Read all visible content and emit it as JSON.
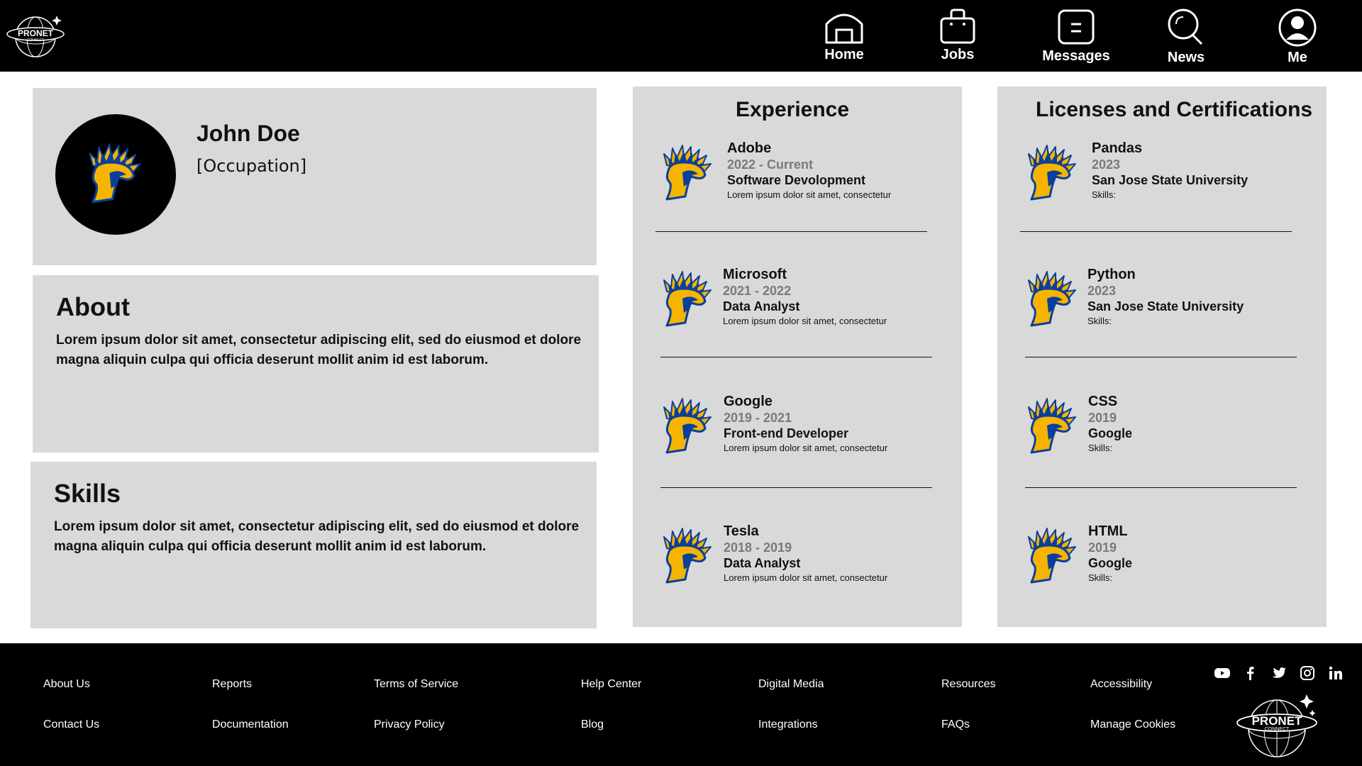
{
  "brand": {
    "logo_text": "PRONET",
    "logo_sub": "CONNECT"
  },
  "nav": {
    "items": [
      {
        "label": "Home",
        "icon": "home-icon"
      },
      {
        "label": "Jobs",
        "icon": "briefcase-icon"
      },
      {
        "label": "Messages",
        "icon": "message-icon"
      },
      {
        "label": "News",
        "icon": "search-icon"
      },
      {
        "label": "Me",
        "icon": "user-icon"
      }
    ]
  },
  "profile": {
    "name": "John Doe",
    "occupation": "[Occupation]"
  },
  "about": {
    "title": "About",
    "body": "Lorem ipsum dolor sit amet, consectetur adipiscing elit, sed do eiusmod  et dolore magna aliquin culpa qui officia deserunt mollit anim id est laborum."
  },
  "skills": {
    "title": "Skills",
    "body": "Lorem ipsum dolor sit amet, consectetur adipiscing elit, sed do eiusmod  et dolore magna aliquin culpa qui officia deserunt mollit anim id est laborum."
  },
  "experience": {
    "title": "Experience",
    "items": [
      {
        "company": "Adobe",
        "dates": "2022 - Current",
        "role": "Software Devolopment",
        "desc": "Lorem ipsum dolor sit amet, consectetur"
      },
      {
        "company": "Microsoft",
        "dates": "2021 - 2022",
        "role": "Data Analyst",
        "desc": "Lorem ipsum dolor sit amet, consectetur"
      },
      {
        "company": "Google",
        "dates": "2019 - 2021",
        "role": "Front-end Developer",
        "desc": "Lorem ipsum dolor sit amet, consectetur"
      },
      {
        "company": "Tesla",
        "dates": "2018 - 2019",
        "role": "Data Analyst",
        "desc": "Lorem ipsum dolor sit amet, consectetur"
      }
    ]
  },
  "licenses": {
    "title": "Licenses and Certifications",
    "items": [
      {
        "name": "Pandas",
        "year": "2023",
        "issuer": "San Jose State University",
        "skills": "Skills:"
      },
      {
        "name": "Python",
        "year": "2023",
        "issuer": "San Jose State University",
        "skills": "Skills:"
      },
      {
        "name": "CSS",
        "year": "2019",
        "issuer": "Google",
        "skills": "Skills:"
      },
      {
        "name": "HTML",
        "year": "2019",
        "issuer": "Google",
        "skills": "Skills:"
      }
    ]
  },
  "footer": {
    "links": [
      "About Us",
      "Contact Us",
      "Reports",
      "Documentation",
      "Terms of Service",
      "Privacy Policy",
      "Help Center",
      "Blog",
      "Digital Media",
      "Integrations",
      "Resources",
      "FAQs",
      "Accessibility",
      "Manage Cookies"
    ],
    "social": [
      "youtube-icon",
      "facebook-icon",
      "twitter-icon",
      "instagram-icon",
      "linkedin-icon"
    ]
  },
  "colors": {
    "header_bg": "#000000",
    "card_bg": "#d9d9d9",
    "dates_gray": "#7a7a7a",
    "spartan_gold": "#f5b400",
    "spartan_blue": "#0a3f9c"
  }
}
